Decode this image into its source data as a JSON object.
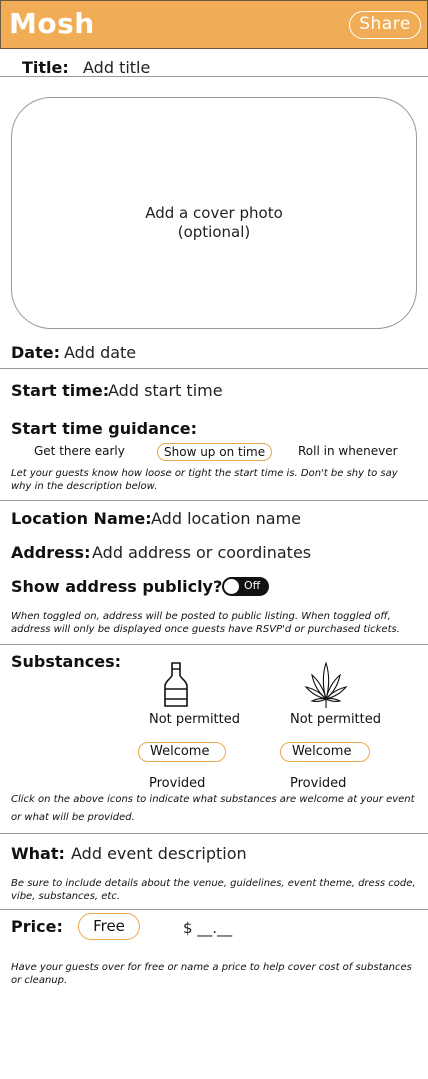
{
  "header": {
    "brand": "Mosh",
    "share_label": "Share",
    "brand_color": "#f0ad55"
  },
  "title": {
    "label": "Title:",
    "placeholder": "Add title"
  },
  "cover": {
    "line1": "Add a cover photo",
    "line2": "(optional)"
  },
  "date": {
    "label": "Date:",
    "placeholder": "Add date"
  },
  "start_time": {
    "label": "Start time:",
    "placeholder": "Add start time"
  },
  "guidance": {
    "label": "Start time guidance:",
    "options": [
      "Get there early",
      "Show up on time",
      "Roll in whenever"
    ],
    "selected": "Show up on time",
    "note": "Let your guests know how loose or tight the start time is. Don't be shy to say why in the description below."
  },
  "location": {
    "label": "Location Name:",
    "placeholder": "Add location name"
  },
  "address": {
    "label": "Address:",
    "placeholder": "Add address or coordinates",
    "public_label": "Show address publicly?",
    "toggle_state": "Off",
    "note": "When toggled on, address will be posted to public listing. When toggled off, address will only be displayed once guests have RSVP'd or purchased tickets."
  },
  "substances": {
    "label": "Substances:",
    "items": [
      {
        "icon": "bottle-icon",
        "status": "Not permitted",
        "welcome": "Welcome",
        "provided": "Provided"
      },
      {
        "icon": "cannabis-leaf-icon",
        "status": "Not permitted",
        "welcome": "Welcome",
        "provided": "Provided"
      }
    ],
    "note": "Click on the above icons to indicate what substances are welcome at your event or what will be provided."
  },
  "what": {
    "label": "What:",
    "placeholder": "Add event description",
    "note": "Be sure to include details about the venue, guidelines, event theme, dress code, vibe, substances, etc."
  },
  "price": {
    "label": "Price:",
    "free_label": "Free",
    "amount_placeholder": "$ __.__",
    "note": "Have your guests over for free or name a price to help cover cost of substances or cleanup."
  },
  "colors": {
    "accent": "#e8a94a",
    "toggle_bg": "#111111"
  }
}
